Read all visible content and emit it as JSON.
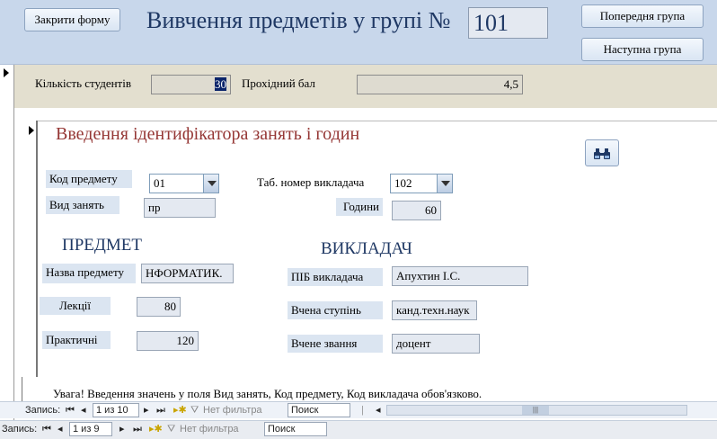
{
  "header": {
    "close_button": "Закрити форму",
    "title": "Вивчення предметів у групі №",
    "group_number": "101",
    "prev_button": "Попередня група",
    "next_button": "Наступна група"
  },
  "main": {
    "students_label": "Кількість студентів",
    "students_value": "30",
    "pass_score_label": "Прохідний бал",
    "pass_score_value": "4,5"
  },
  "subform": {
    "heading": "Введення ідентифікатора занять і годин",
    "subject_code_label": "Код предмету",
    "subject_code_value": "01",
    "teacher_id_label": "Таб. номер викладача",
    "teacher_id_value": "102",
    "class_type_label": "Вид занять",
    "class_type_value": "пр",
    "hours_label": "Години",
    "hours_value": "60",
    "subject_section": "ПРЕДМЕТ",
    "teacher_section": "ВИКЛАДАЧ",
    "subject_name_label": "Назва предмету",
    "subject_name_value": "НФОРМАТИК.",
    "lectures_label": "Лекції",
    "lectures_value": "80",
    "practicals_label": "Практичні",
    "practicals_value": "120",
    "teacher_name_label": "ПІБ викладача",
    "teacher_name_value": "Апухтин І.С.",
    "degree_label": "Вчена ступінь",
    "degree_value": "канд.техн.наук",
    "rank_label": "Вчене звання",
    "rank_value": "доцент",
    "warning": "Увага! Введення значень у поля Вид занять, Код предмету, Код викладача обов'язково."
  },
  "subform_nav": {
    "record_label": "Запись:",
    "position": "1 из 10",
    "filter_label": "Нет фильтра",
    "search_placeholder": "Поиск"
  },
  "main_nav": {
    "record_label": "Запись:",
    "position": "1 из 9",
    "filter_label": "Нет фильтра",
    "search_placeholder": "Поиск"
  },
  "icons": {
    "find": "binoculars-icon"
  }
}
